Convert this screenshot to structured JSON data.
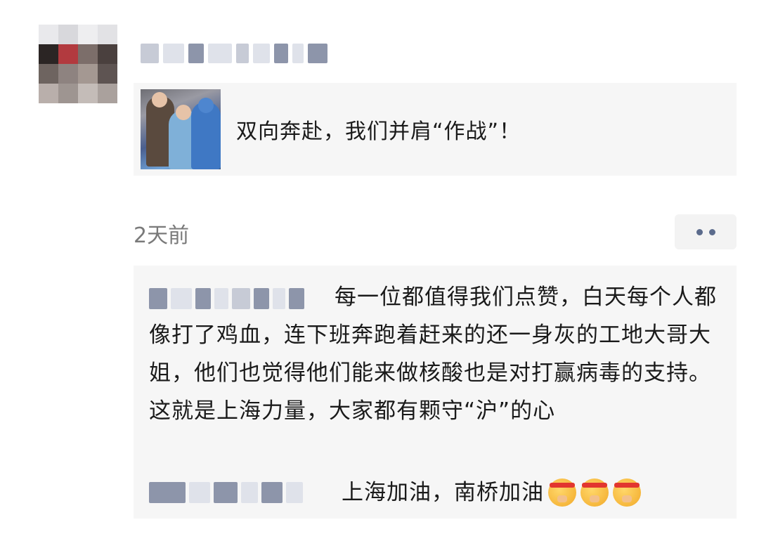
{
  "post": {
    "link_title": "双向奔赴，我们并肩“作战”！",
    "time": "2天前"
  },
  "comments": [
    {
      "text": "每一位都值得我们点赞，白天每个人都像打了鸡血，连下班奔跑着赶来的还一身灰的工地大哥大姐，他们也觉得他们能来做核酸也是对打赢病毒的支持。这就是上海力量，大家都有颗守“沪”的心"
    },
    {
      "text": "上海加油，南桥加油"
    }
  ],
  "icons": {
    "more": "more-dots-icon",
    "emoji": "fighting-face-emoji"
  },
  "colors": {
    "card_bg": "#f6f6f6",
    "time_text": "#7a7a7a",
    "more_dots": "#5b6b8c"
  }
}
